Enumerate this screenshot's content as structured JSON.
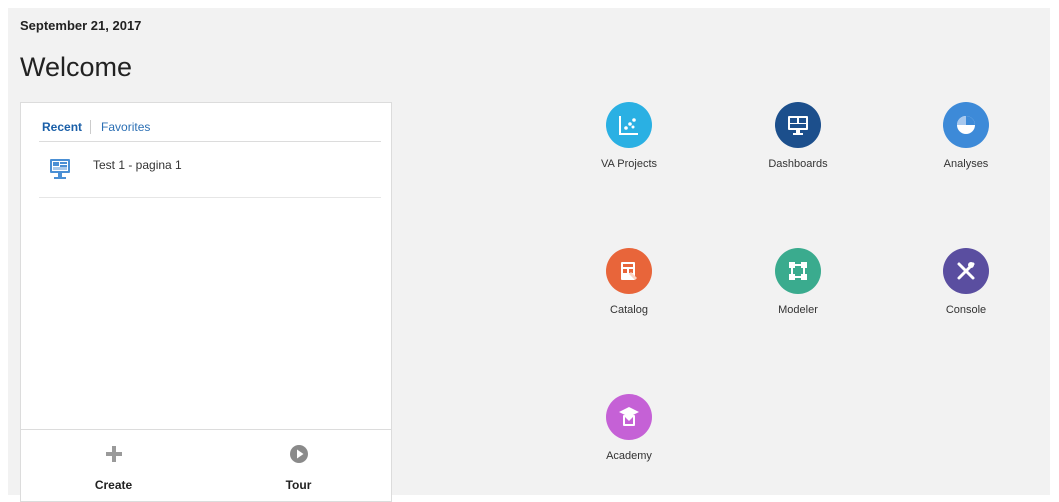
{
  "header": {
    "date": "September 21, 2017",
    "title": "Welcome"
  },
  "panel": {
    "tabs": [
      {
        "label": "Recent"
      },
      {
        "label": "Favorites"
      }
    ],
    "recent_items": [
      {
        "label": "Test 1 - pagina 1",
        "icon": "dashboard-icon"
      }
    ],
    "footer": {
      "create": {
        "label": "Create",
        "icon": "plus-icon"
      },
      "tour": {
        "label": "Tour",
        "icon": "play-icon"
      }
    }
  },
  "tiles": [
    {
      "label": "VA Projects",
      "icon": "scatter-chart-icon",
      "color": "#2ab0e3"
    },
    {
      "label": "Dashboards",
      "icon": "monitor-icon",
      "color": "#1c4f8c"
    },
    {
      "label": "Analyses",
      "icon": "pie-chart-icon",
      "color": "#3d8ad8"
    },
    {
      "label": "Catalog",
      "icon": "catalog-icon",
      "color": "#e8653a"
    },
    {
      "label": "Modeler",
      "icon": "modeler-icon",
      "color": "#3aab8e"
    },
    {
      "label": "Console",
      "icon": "tools-icon",
      "color": "#5a4ea0"
    },
    {
      "label": "Academy",
      "icon": "academy-icon",
      "color": "#c561d6"
    }
  ]
}
